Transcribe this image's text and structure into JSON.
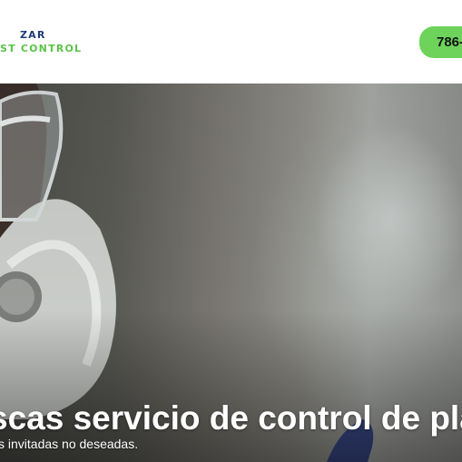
{
  "header": {
    "logo_line1": "ZAR",
    "logo_line2": "ST CONTROL",
    "phone": "786-"
  },
  "hero": {
    "title": "scas servicio de control de plaga",
    "subtitle": "s invitadas no deseadas."
  },
  "colors": {
    "logo_blue": "#1f3b74",
    "logo_green": "#5cc24a",
    "phone_button": "#6dd35a"
  }
}
